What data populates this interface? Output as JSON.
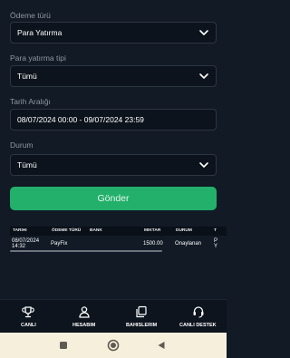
{
  "filters": {
    "payment_type": {
      "label": "Ödeme türü",
      "value": "Para Yatırma"
    },
    "deposit_type": {
      "label": "Para yatırma tipi",
      "value": "Tümü"
    },
    "date_range": {
      "label": "Tarih Aralığı",
      "value": "08/07/2024 00:00 - 09/07/2024 23:59"
    },
    "status": {
      "label": "Durum",
      "value": "Tümü"
    }
  },
  "submit_label": "Gönder",
  "table": {
    "headers": [
      "TARIHI",
      "ÖDEME TÜRÜ",
      "BANK",
      "MIKTAR",
      "DURUM",
      "T"
    ],
    "rows": [
      {
        "date": "08/07/2024",
        "time": "14:32",
        "payment_type": "PayFix",
        "bank": "",
        "amount": "1500.00",
        "status": "Onaylanan",
        "extra1": "P",
        "extra2": "Y"
      }
    ]
  },
  "nav": [
    {
      "label": "CANLI",
      "icon": "trophy-icon"
    },
    {
      "label": "HESABIM",
      "icon": "user-icon"
    },
    {
      "label": "BAHISLERIM",
      "icon": "bets-icon"
    },
    {
      "label": "CANLI DESTEK",
      "icon": "headset-icon"
    }
  ],
  "colors": {
    "background": "#111a25",
    "accent": "#22b06a",
    "field_bg": "#0c131c",
    "system_bar": "#f6efdc"
  }
}
